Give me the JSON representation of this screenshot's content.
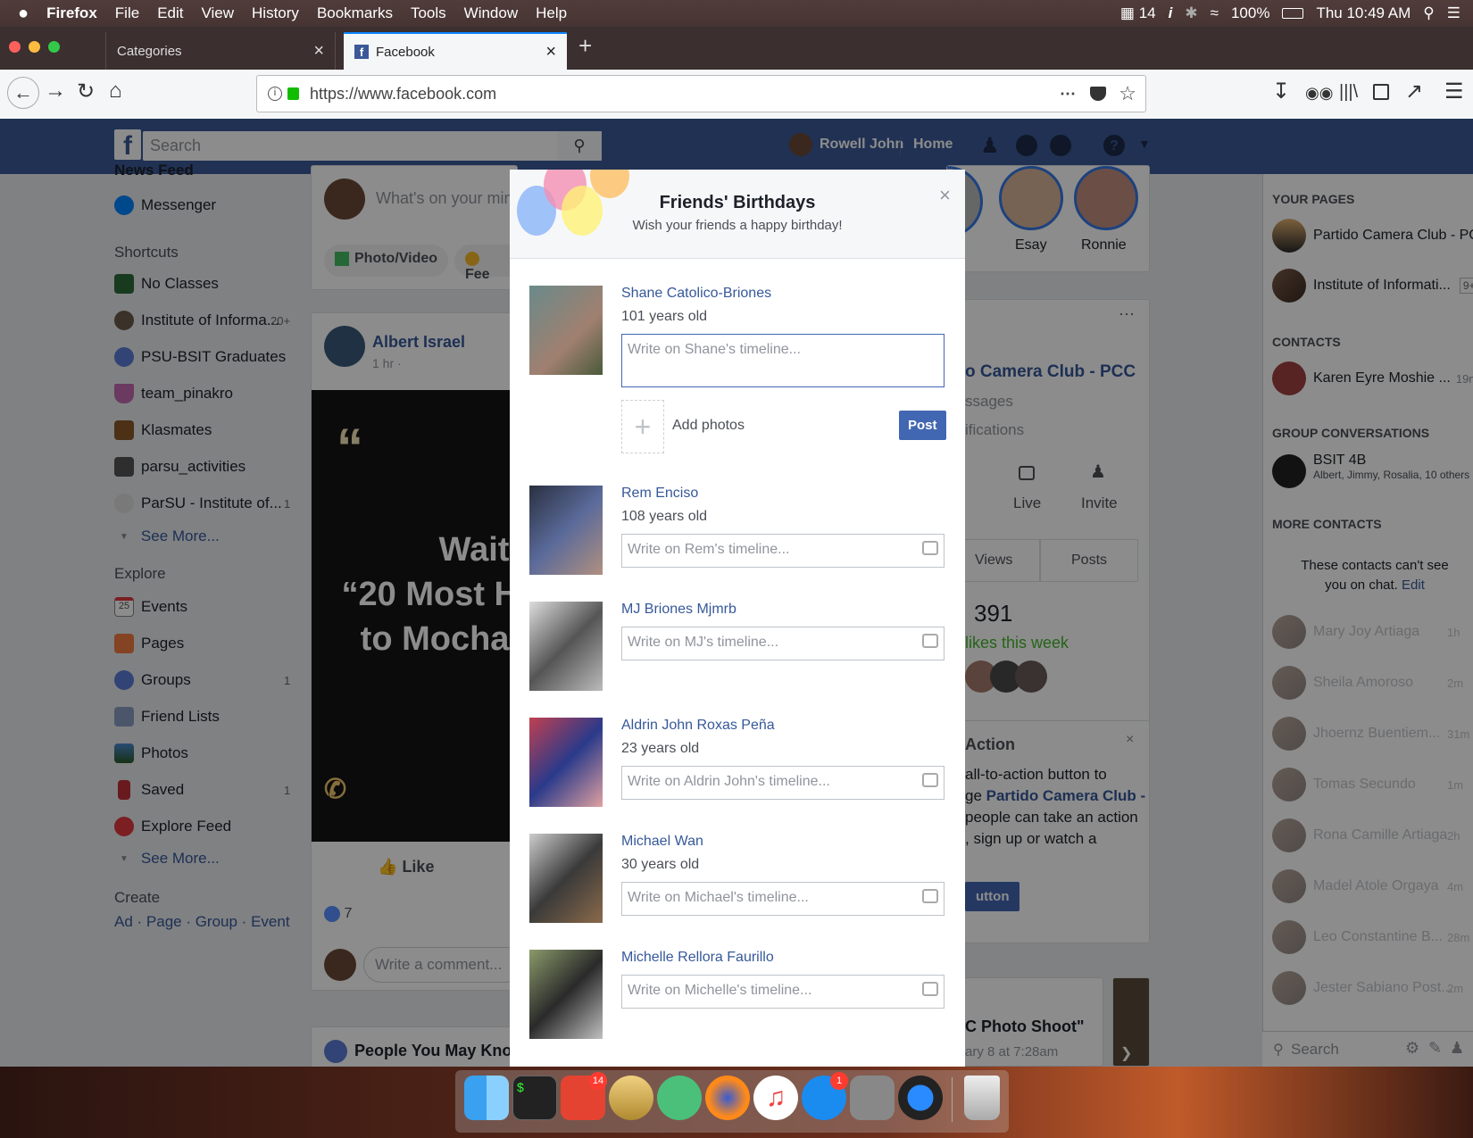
{
  "menubar": {
    "apple": "",
    "app": "Firefox",
    "menus": [
      "File",
      "Edit",
      "View",
      "History",
      "Bookmarks",
      "Tools",
      "Window",
      "Help"
    ],
    "status": {
      "calendar": "14",
      "battery": "100%",
      "clock": "Thu 10:49 AM"
    }
  },
  "tabs": [
    {
      "label": "Categories"
    },
    {
      "label": "Facebook"
    }
  ],
  "urlbar": {
    "url": "https://www.facebook.com"
  },
  "fb": {
    "search_placeholder": "Search",
    "user": "Rowell John",
    "home": "Home"
  },
  "left_sidebar": {
    "partial_top": "News Feed",
    "messenger": "Messenger",
    "shortcuts_title": "Shortcuts",
    "shortcuts": [
      {
        "label": "No Classes",
        "count": ""
      },
      {
        "label": "Institute of Informa...",
        "count": "20+"
      },
      {
        "label": "PSU-BSIT Graduates",
        "count": ""
      },
      {
        "label": "team_pinakro",
        "count": ""
      },
      {
        "label": "Klasmates",
        "count": ""
      },
      {
        "label": "parsu_activities",
        "count": ""
      },
      {
        "label": "ParSU - Institute of...",
        "count": "1"
      }
    ],
    "see_more": "See More...",
    "explore_title": "Explore",
    "explore": [
      {
        "label": "Events",
        "count": "",
        "icon_text": "25"
      },
      {
        "label": "Pages",
        "count": "",
        "icon_text": ""
      },
      {
        "label": "Groups",
        "count": "1",
        "icon_text": ""
      },
      {
        "label": "Friend Lists",
        "count": "",
        "icon_text": ""
      },
      {
        "label": "Photos",
        "count": "",
        "icon_text": ""
      },
      {
        "label": "Saved",
        "count": "1",
        "icon_text": ""
      },
      {
        "label": "Explore Feed",
        "count": "",
        "icon_text": ""
      }
    ],
    "see_more2": "See More...",
    "create_title": "Create",
    "create_links": "Ad · Page · Group · Event"
  },
  "feed": {
    "composer_placeholder": "What's on your mind",
    "photo_video": "Photo/Video",
    "feeling": "Fee",
    "post_author": "Albert Israel",
    "post_time": "1 hr ·",
    "post_text_1": "Waiti",
    "post_text_2": "“20 Most H",
    "post_text_3": "to Mocha’",
    "like": "Like",
    "reactions": "7",
    "comment_placeholder": "Write a comment...",
    "pymk": "People You May Know"
  },
  "right_column": {
    "stories": [
      "Esay",
      "Ronnie"
    ],
    "page_title": "o Camera Club - PCC",
    "messages": "ssages",
    "notifications": "ifications",
    "live": "Live",
    "invite": "Invite",
    "tab_views": "Views",
    "tab_posts": "Posts",
    "likes_count": "391",
    "likes_week": "likes this week",
    "action_title": "Action",
    "action_text_1": "all-to-action button to",
    "action_text_2_prefix": "ge ",
    "action_text_2_link": "Partido Camera Club -",
    "action_text_3": "people can take an action",
    "action_text_4": ", sign up or watch a",
    "action_button": "utton",
    "event_title": "C Photo Shoot\"",
    "event_date": "ary 8 at 7:28am"
  },
  "chat_sidebar": {
    "your_pages": "YOUR PAGES",
    "pages": [
      {
        "name": "Partido Camera Club - PCC",
        "badge": ""
      },
      {
        "name": "Institute of Informati...",
        "badge": "9+"
      }
    ],
    "contacts_title": "CONTACTS",
    "contacts": [
      {
        "name": "Karen Eyre Moshie ...",
        "time": "19m"
      }
    ],
    "group_title": "GROUP CONVERSATIONS",
    "group": {
      "name": "BSIT 4B",
      "members": "Albert, Jimmy, Rosalia, 10 others"
    },
    "more_contacts": "MORE CONTACTS",
    "notice": "These contacts can't see you on chat.",
    "notice_edit": "Edit",
    "offline": [
      {
        "name": "Mary Joy Artiaga",
        "time": "1h"
      },
      {
        "name": "Sheila Amoroso",
        "time": "2m"
      },
      {
        "name": "Jhoernz Buentiem...",
        "time": "31m"
      },
      {
        "name": "Tomas Secundo",
        "time": "1m"
      },
      {
        "name": "Rona Camille Artiaga",
        "time": "2h"
      },
      {
        "name": "Madel Atole Orgaya",
        "time": "4m"
      },
      {
        "name": "Leo Constantine B...",
        "time": "28m"
      },
      {
        "name": "Jester Sabiano Post...",
        "time": "2m"
      }
    ],
    "search_placeholder": "Search"
  },
  "modal": {
    "title": "Friends' Birthdays",
    "subtitle": "Wish your friends a happy birthday!",
    "close": "×",
    "add_photos": "Add photos",
    "post": "Post",
    "friends": [
      {
        "name": "Shane Catolico-Briones",
        "age": "101 years old",
        "placeholder": "Write on Shane's timeline...",
        "photo": "#7a8a6a"
      },
      {
        "name": "Rem Enciso",
        "age": "108 years old",
        "placeholder": "Write on Rem's timeline...",
        "photo": "#3a4a6a"
      },
      {
        "name": "MJ Briones Mjmrb",
        "age": "",
        "placeholder": "Write on MJ's timeline...",
        "photo": "#777777"
      },
      {
        "name": "Aldrin John Roxas Peña",
        "age": "23 years old",
        "placeholder": "Write on Aldrin John's timeline...",
        "photo": "#2a3a7a"
      },
      {
        "name": "Michael Wan",
        "age": "30 years old",
        "placeholder": "Write on Michael's timeline...",
        "photo": "#5a4a3a"
      },
      {
        "name": "Michelle Rellora Faurillo",
        "age": "",
        "placeholder": "Write on Michelle's timeline...",
        "photo": "#6a7a5a"
      }
    ]
  },
  "dock": {
    "todoist_badge": "14",
    "appstore_badge": "1"
  },
  "colors": {
    "fb_blue": "#3b5998",
    "link": "#365899",
    "menubar": "#4a3736"
  }
}
